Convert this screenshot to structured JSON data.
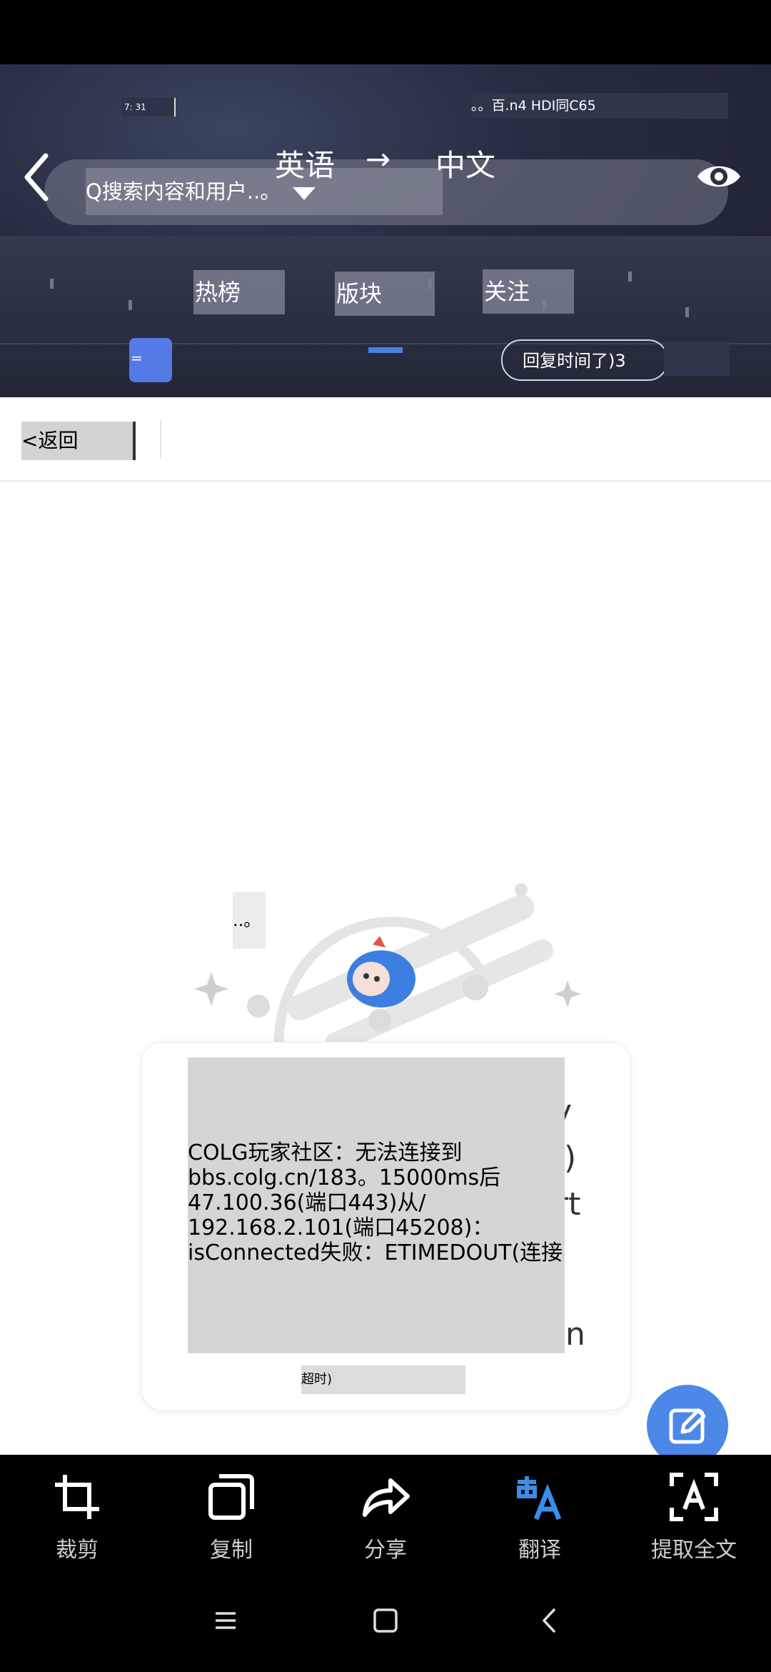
{
  "status": {
    "time_left": "7: 31",
    "right": "。。百.n4 HDI同C65"
  },
  "search": {
    "placeholder": "Q搜索内容和用户..。"
  },
  "translate": {
    "from": "英语",
    "arrow": "→",
    "to": "中文"
  },
  "tabs": [
    {
      "label": "热榜"
    },
    {
      "label": "版块"
    },
    {
      "label": "关注"
    }
  ],
  "menu_glyph": "=",
  "reply": {
    "label": "回复时间了)3"
  },
  "back": {
    "label": "<返回"
  },
  "dots": "..。",
  "error": {
    "lines": [
      "COLG玩家社区：无法连接到",
      "bbs.colg.cn/183。15000ms后",
      "47.100.36(端口443)从/",
      "192.168.2.101(端口45208)：",
      "isConnected失败：ETIMEDOUT(连接"
    ],
    "timeout": "超时)",
    "ghost": [
      "y",
      ")",
      "rt",
      "n"
    ]
  },
  "toolbar": {
    "items": [
      {
        "label": "裁剪",
        "icon": "crop-icon"
      },
      {
        "label": "复制",
        "icon": "copy-icon"
      },
      {
        "label": "分享",
        "icon": "share-icon"
      },
      {
        "label": "翻译",
        "icon": "translate-icon"
      },
      {
        "label": "提取全文",
        "icon": "extract-text-icon"
      }
    ]
  },
  "colors": {
    "accent": "#4b88e8",
    "tab_indicator": "#4a7fe6"
  }
}
